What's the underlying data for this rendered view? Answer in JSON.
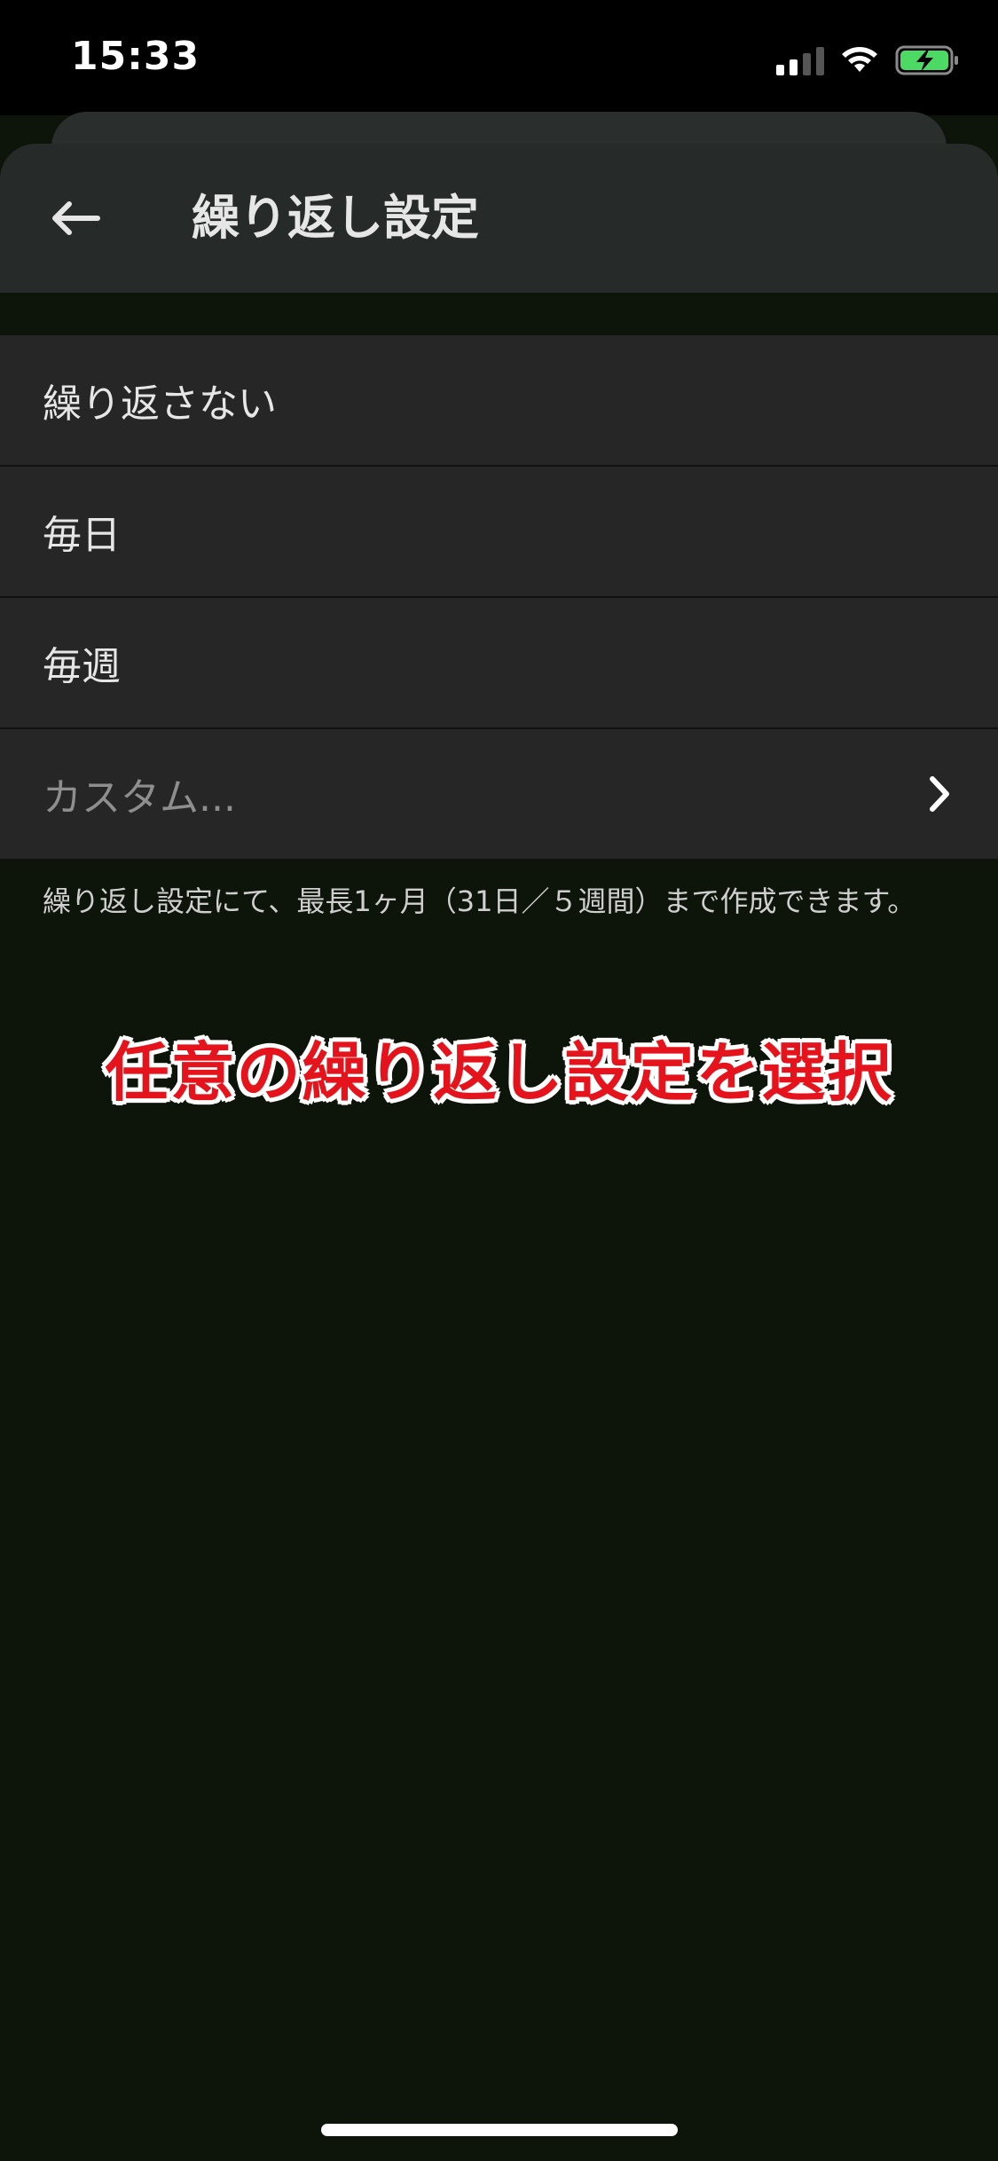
{
  "status_bar": {
    "time": "15:33",
    "icons": [
      "cellular-signal-icon",
      "wifi-icon",
      "battery-charging-icon"
    ]
  },
  "header": {
    "back_icon": "arrow-left-icon",
    "title": "繰り返し設定"
  },
  "options": [
    {
      "label": "繰り返さない"
    },
    {
      "label": "毎日"
    },
    {
      "label": "毎週"
    },
    {
      "label": "カスタム...",
      "icon": "chevron-right-icon"
    }
  ],
  "note": "繰り返し設定にて、最長1ヶ月（31日／５週間）まで作成できます。",
  "annotation": "任意の繰り返し設定を選択",
  "colors": {
    "background": "#0d1409",
    "header": "#262a28",
    "row": "#262626",
    "annotation_text": "#e5141c",
    "battery": "#4cd964"
  }
}
